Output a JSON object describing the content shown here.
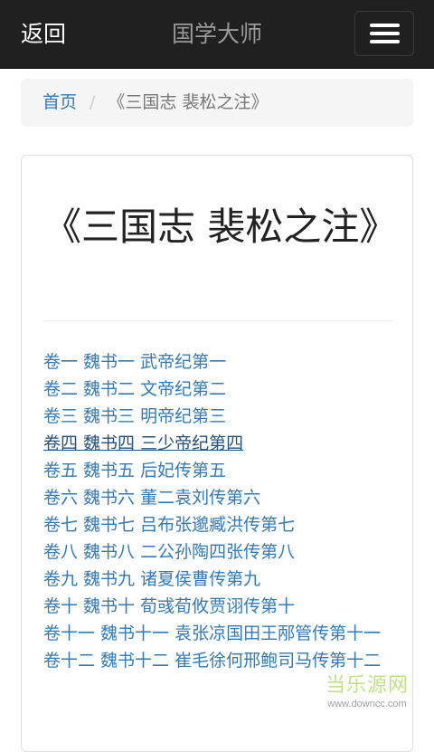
{
  "navbar": {
    "back_label": "返回",
    "title": "国学大师",
    "menu_icon": "hamburger-menu-icon"
  },
  "breadcrumb": {
    "home": "首页",
    "separator": "/",
    "current": "《三国志 裴松之注》"
  },
  "book": {
    "title": "《三国志 裴松之注》",
    "chapters": [
      "卷一 魏书一 武帝纪第一",
      "卷二 魏书二 文帝纪第二",
      "卷三 魏书三 明帝纪第三",
      "卷四 魏书四 三少帝纪第四",
      "卷五 魏书五 后妃传第五",
      "卷六 魏书六 董二袁刘传第六",
      "卷七 魏书七 吕布张邈臧洪传第七",
      "卷八 魏书八 二公孙陶四张传第八",
      "卷九 魏书九 诸夏侯曹传第九",
      "卷十 魏书十 荀彧荀攸贾诩传第十",
      "卷十一 魏书十一 袁张凉国田王邴管传第十一",
      "卷十二 魏书十二 崔毛徐何邢鲍司马传第十二"
    ],
    "visited_chapter_index": 3
  },
  "watermark": {
    "main": "当乐源网",
    "sub": "www.downcc.com"
  },
  "colors": {
    "navbar_bg": "#202020",
    "link": "#337ab7",
    "visited_link": "#23527c",
    "breadcrumb_bg": "#f5f5f5"
  }
}
